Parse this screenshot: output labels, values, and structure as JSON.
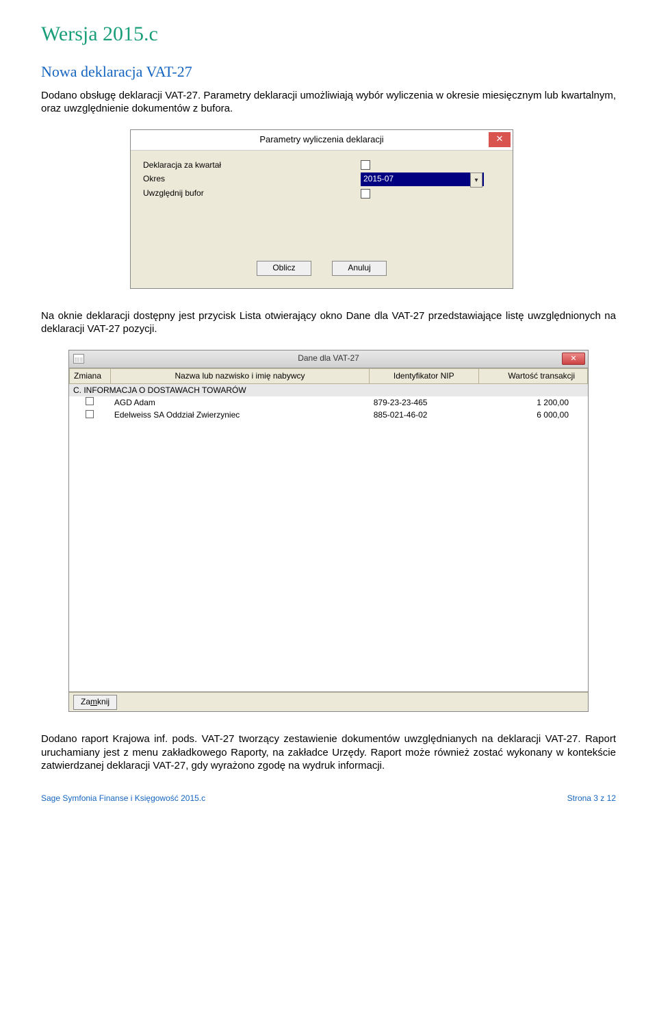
{
  "h1": "Wersja 2015.c",
  "h2": "Nowa deklaracja VAT-27",
  "para1": "Dodano obsługę deklaracji VAT-27. Parametry deklaracji umożliwiają wybór wyliczenia w okresie miesięcznym lub kwartalnym, oraz uwzględnienie dokumentów z bufora.",
  "dialog1": {
    "title": "Parametry wyliczenia deklaracji",
    "close": "✕",
    "row1_label": "Deklaracja za kwartał",
    "row2_label": "Okres",
    "row2_value": "2015-07",
    "row3_label": "Uwzględnij bufor",
    "btn_oblicz": "Oblicz",
    "btn_anuluj": "Anuluj"
  },
  "para2": "Na oknie deklaracji dostępny jest przycisk Lista otwierający okno Dane dla VAT-27 przedstawiające listę uwzględnionych na deklaracji VAT-27 pozycji.",
  "window2": {
    "title": "Dane dla VAT-27",
    "close": "✕",
    "headers": {
      "zmiana": "Zmiana",
      "nazwa": "Nazwa lub nazwisko i imię nabywcy",
      "nip": "Identyfikator NIP",
      "wart": "Wartość transakcji"
    },
    "section": "C. INFORMACJA O DOSTAWACH TOWARÓW",
    "rows": [
      {
        "nazwa": "AGD Adam",
        "nip": "879-23-23-465",
        "wart": "1 200,00"
      },
      {
        "nazwa": "Edelweiss SA Oddział Zwierzyniec",
        "nip": "885-021-46-02",
        "wart": "6 000,00"
      }
    ],
    "footer_btn_prefix": "Za",
    "footer_btn_ul": "m",
    "footer_btn_suffix": "knij"
  },
  "para3": "Dodano raport Krajowa inf. pods. VAT-27 tworzący zestawienie dokumentów uwzględnianych na deklaracji VAT-27. Raport uruchamiany jest z menu zakładkowego Raporty, na zakładce Urzędy. Raport może również zostać wykonany w kontekście zatwierdzanej deklaracji VAT-27, gdy wyrażono zgodę na wydruk informacji.",
  "footer": {
    "left": "Sage Symfonia Finanse i Księgowość 2015.c",
    "right": "Strona 3 z 12"
  }
}
